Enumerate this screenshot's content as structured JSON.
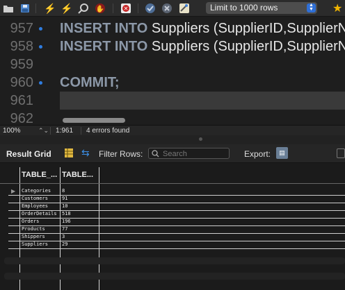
{
  "toolbar": {
    "limit_select": "Limit to 1000 rows",
    "icons": [
      "folder-icon",
      "save-icon",
      "execute-icon",
      "execute-current-icon",
      "explain-icon",
      "stop-icon",
      "toggle-error-icon",
      "commit-icon",
      "rollback-icon",
      "beautify-icon",
      "bookmark-star-icon"
    ]
  },
  "editor": {
    "lines": [
      {
        "num": "957",
        "marker": true,
        "keyword": "INSERT INTO",
        "rest": " Suppliers (SupplierID,SupplierN"
      },
      {
        "num": "958",
        "marker": true,
        "keyword": "INSERT INTO",
        "rest": " Suppliers (SupplierID,SupplierN"
      },
      {
        "num": "959",
        "marker": false,
        "keyword": "",
        "rest": ""
      },
      {
        "num": "960",
        "marker": true,
        "keyword": "COMMIT;",
        "rest": ""
      },
      {
        "num": "961",
        "marker": false,
        "keyword": "",
        "rest": ""
      },
      {
        "num": "962",
        "marker": false,
        "keyword": "",
        "rest": ""
      }
    ]
  },
  "status": {
    "zoom": "100%",
    "position": "1:961",
    "errors": "4 errors found"
  },
  "result": {
    "title": "Result Grid",
    "filter_label": "Filter Rows:",
    "search_placeholder": "Search",
    "export_label": "Export:",
    "columns": [
      "TABLE_...",
      "TABLE..."
    ],
    "rows": [
      [
        "Categories",
        "8"
      ],
      [
        "Customers",
        "91"
      ],
      [
        "Employees",
        "10"
      ],
      [
        "OrderDetails",
        "518"
      ],
      [
        "Orders",
        "196"
      ],
      [
        "Products",
        "77"
      ],
      [
        "Shippers",
        "3"
      ],
      [
        "Suppliers",
        "29"
      ]
    ]
  },
  "colors": {
    "background": "#1e1e1e",
    "keyword": "#8c98a8",
    "marker": "#2f7de1",
    "select_accent": "#2f6fd6"
  }
}
